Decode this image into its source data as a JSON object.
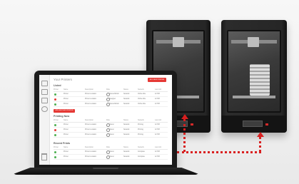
{
  "app": {
    "title": "Your Printers",
    "primary_button": "ADD NEW PRINTER",
    "add_button": "ADD ANOTHER PRINTER"
  },
  "columns": [
    "Printer",
    "Name",
    "Description",
    "Role",
    "Status",
    "Network",
    "Last Job"
  ],
  "sections": [
    {
      "title": "Listed",
      "rows": [
        {
          "status_color": "#4caf50",
          "name": "Printer",
          "desc": "Printer Location",
          "role": "Owner/Admin",
          "status": "Network",
          "network": "Online Idle",
          "last": "12 PM"
        },
        {
          "status_color": "#e53935",
          "name": "Printer",
          "desc": "Printer Location",
          "role": "Designer",
          "status": "Network",
          "network": "Online Idle",
          "last": "12 PM"
        },
        {
          "status_color": "#4caf50",
          "name": "Printer",
          "desc": "Printer Location",
          "role": "Owner/Admin",
          "status": "Network",
          "network": "Online Idle",
          "last": "12 PM"
        }
      ]
    },
    {
      "title": "Printing Now",
      "rows": [
        {
          "status_color": "#4caf50",
          "name": "Printer",
          "desc": "Printer Location",
          "role": "Owner",
          "status": "Network",
          "network": "Printing",
          "last": "12 PM"
        },
        {
          "status_color": "#e53935",
          "name": "Printer",
          "desc": "Printer Location",
          "role": "Owner",
          "status": "Network",
          "network": "Printing",
          "last": "12 PM"
        },
        {
          "status_color": "#4caf50",
          "name": "Printer",
          "desc": "Printer Location",
          "role": "Owner",
          "status": "Network",
          "network": "Printing",
          "last": "12 PM"
        }
      ]
    },
    {
      "title": "Recent Prints",
      "rows": [
        {
          "status_color": "#4caf50",
          "name": "Printer",
          "desc": "Printer Location",
          "role": "Owner",
          "status": "Network",
          "network": "Complete",
          "last": "12 PM"
        },
        {
          "status_color": "#4caf50",
          "name": "Printer",
          "desc": "Printer Location",
          "role": "Owner",
          "status": "Network",
          "network": "Complete",
          "last": "12 PM"
        }
      ]
    }
  ],
  "colors": {
    "accent": "#e53935",
    "connector": "#d92020",
    "laptop": "#1b1b1b",
    "printer": "#1f1f1f"
  }
}
